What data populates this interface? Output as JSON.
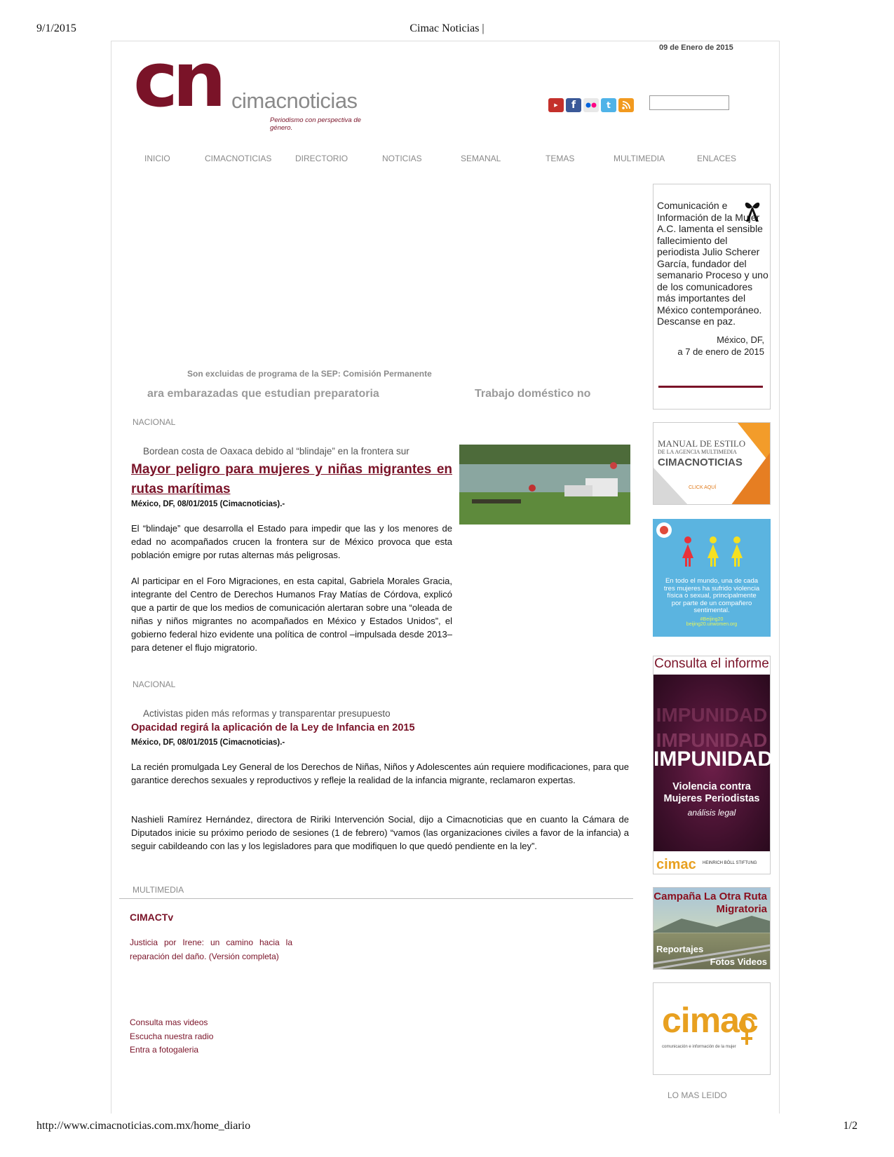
{
  "print": {
    "date": "9/1/2015",
    "title": "Cimac Noticias |",
    "url": "http://www.cimacnoticias.com.mx/home_diario",
    "page": "1/2"
  },
  "header": {
    "date": "09 de Enero de 2015",
    "logo_mark": "cn",
    "logo_word": "cimacnoticias",
    "tagline": "Periodismo con perspectiva de género.",
    "social_icons": [
      "youtube-icon",
      "facebook-icon",
      "flickr-icon",
      "twitter-icon",
      "rss-icon"
    ],
    "search_value": ""
  },
  "nav": {
    "items": [
      "INICIO",
      "CIMACNOTICIAS",
      "DIRECTORIO",
      "NOTICIAS",
      "SEMANAL",
      "TEMAS",
      "MULTIMEDIA",
      "ENLACES"
    ]
  },
  "slider": {
    "caption": "Son excluidas de programa de la SEP: Comisión Permanente",
    "ticker_left": "ara embarazadas que estudian preparatoria",
    "ticker_right": "Trabajo doméstico no"
  },
  "articles": [
    {
      "section": "NACIONAL",
      "kicker": "Bordean costa de Oaxaca debido al “blindaje” en la frontera sur",
      "headline": "Mayor peligro para mujeres y niñas migrantes en rutas marítimas",
      "dateline": "México, DF, 08/01/2015 (Cimacnoticias).-",
      "paragraphs": [
        "El “blindaje” que desarrolla el Estado para impedir que las y los menores de edad no acompañados crucen la frontera sur de México provoca que esta población emigre por rutas alternas más peligrosas.",
        "Al participar en el Foro Migraciones, en esta capital, Gabriela Morales Gracia, integrante del Centro de Derechos Humanos Fray Matías de Córdova, explicó que a partir de que los medios de comunicación alertaran sobre una “oleada de niñas y niños migrantes no acompañados en México y Estados Unidos”, el gobierno federal hizo evidente una política de control –impulsada desde 2013– para detener el flujo migratorio."
      ]
    },
    {
      "section": "NACIONAL",
      "kicker": "Activistas piden más reformas y transparentar presupuesto",
      "headline": "Opacidad regirá la aplicación de la Ley de Infancia en 2015",
      "dateline": "México, DF, 08/01/2015 (Cimacnoticias).-",
      "paragraphs": [
        "La recién promulgada Ley General de los Derechos de Niñas, Niños y Adolescentes aún requiere modificaciones, para que garantice derechos sexuales y reproductivos y refleje la realidad de la infancia migrante, reclamaron expertas.",
        "Nashieli Ramírez Hernández, directora de Ririki Intervención Social, dijo a Cimacnoticias que en cuanto la Cámara de Diputados inicie su próximo periodo de sesiones (1 de febrero) “vamos (las organizaciones civiles a favor de la infancia) a seguir cabildeando con las y los legisladores para que modifiquen lo que quedó pendiente en la ley”."
      ]
    }
  ],
  "multimedia": {
    "section": "MULTIMEDIA",
    "title": "CIMACTv",
    "video_desc": "Justicia por Irene: un camino hacia la reparación del daño. (Versión completa)",
    "links": [
      "Consulta mas videos",
      "Escucha nuestra radio",
      "Entra a fotogaleria"
    ]
  },
  "sidebar": {
    "condolence": {
      "message": "Comunicación e Información de la Mujer A.C. lamenta el sensible fallecimiento del periodista Julio Scherer García, fundador del semanario Proceso y uno de los comunicadores más importantes del México contemporáneo. Descanse en paz.",
      "place": "México, DF,",
      "date": "a 7 de enero de 2015"
    },
    "manual": {
      "line1": "MANUAL DE ESTILO",
      "line2": "DE LA AGENCIA MULTIMEDIA",
      "line3": "CIMACNOTICIAS",
      "cta": "CLICK AQUÍ"
    },
    "beijing": {
      "text": "En todo el mundo, una de cada tres mujeres ha sufrido violencia física o sexual, principalmente por parte de un compañero sentimental.",
      "hashtag": "#Beijing20",
      "site": "beijing20.unwomen.org"
    },
    "impunidad": {
      "consulta": "Consulta el informe",
      "ghost": "IMPUNIDAD",
      "title": "IMPUNIDAD",
      "subtitle": "Violencia contra Mujeres Periodistas",
      "subtitle2": "análisis legal",
      "org1": "cimac",
      "org2": "HEINRICH BÖLL STIFTUNG"
    },
    "campana": {
      "title": "Campaña La Otra Ruta Migratoria",
      "reportajes": "Reportajes",
      "fotos_videos": "Fotos Videos"
    },
    "cimac": {
      "name": "cimac",
      "sub": "comunicación e información de la mujer"
    },
    "lo_mas_leido": "LO MAS LEIDO"
  }
}
